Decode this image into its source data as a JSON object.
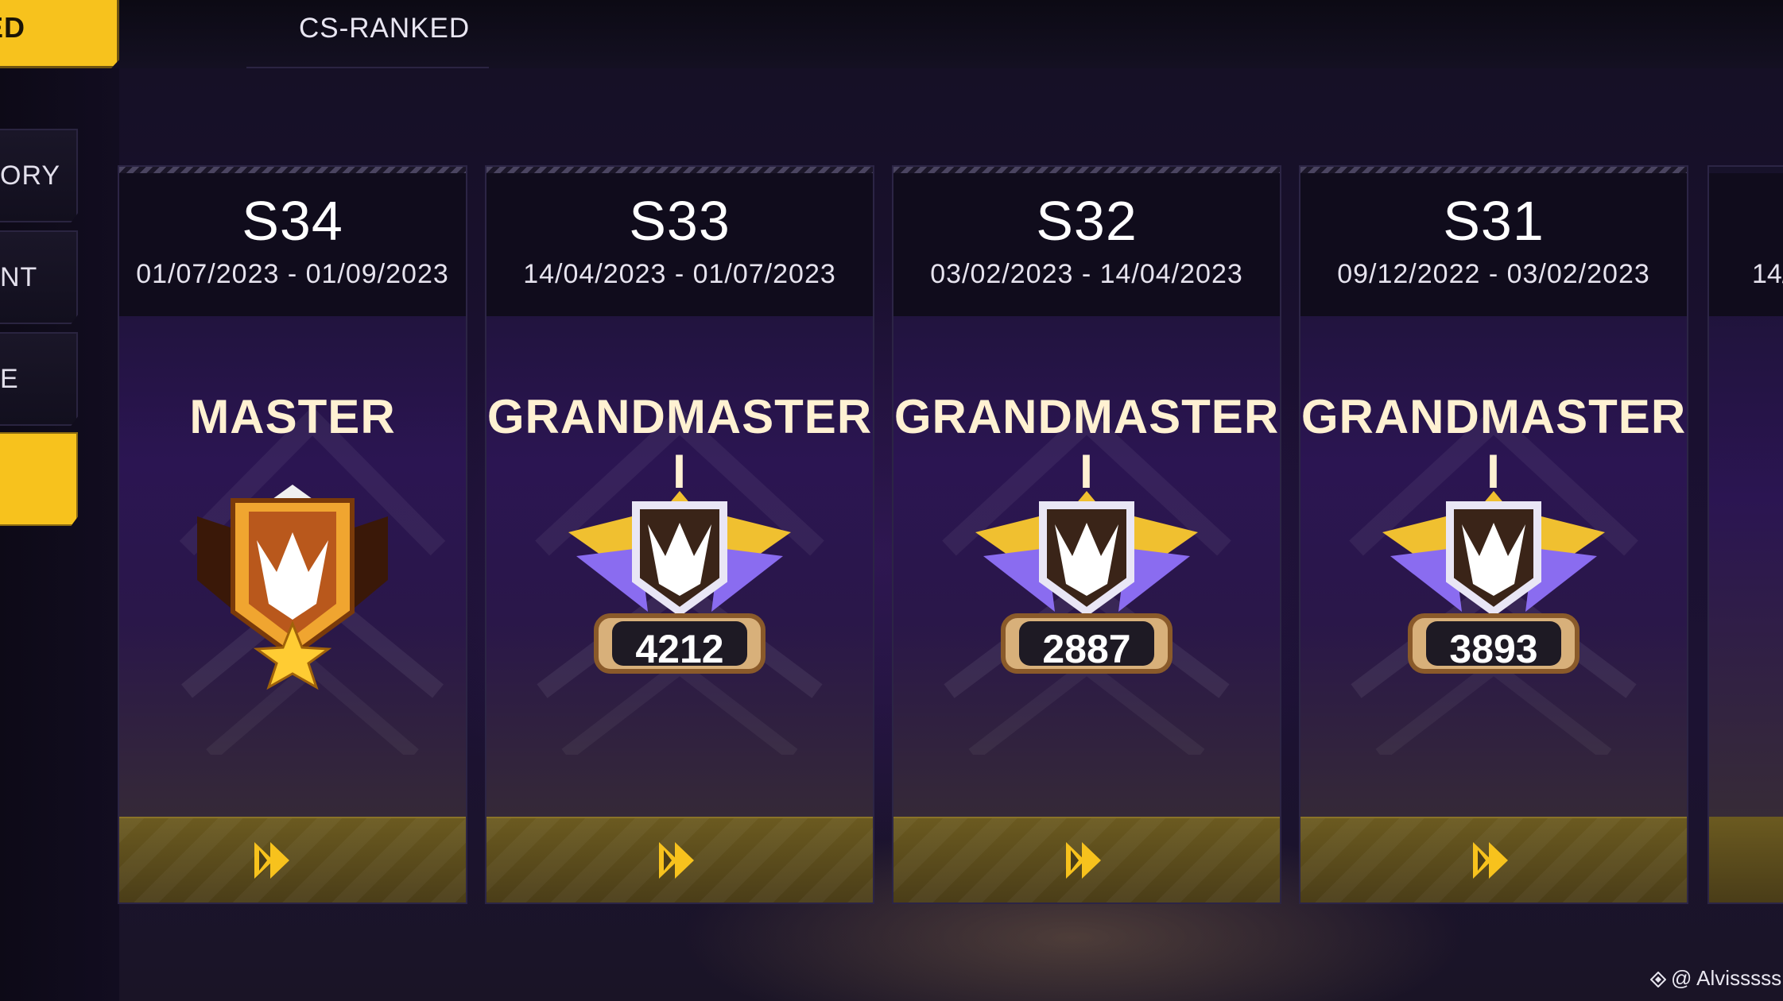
{
  "tabs": {
    "active_label": "ED",
    "cs_label": "CS-RANKED"
  },
  "sidebar": {
    "items": [
      {
        "label": "ORY"
      },
      {
        "label": "NT"
      },
      {
        "label": "E"
      },
      {
        "label": ""
      }
    ]
  },
  "cards": [
    {
      "season": "S34",
      "dates": "01/07/2023 - 01/09/2023",
      "rank": "MASTER",
      "score": "",
      "badge": "master-badge-icon"
    },
    {
      "season": "S33",
      "dates": "14/04/2023 - 01/07/2023",
      "rank": "GRANDMASTER I",
      "score": "4212",
      "badge": "grandmaster-badge-icon"
    },
    {
      "season": "S32",
      "dates": "03/02/2023 - 14/04/2023",
      "rank": "GRANDMASTER I",
      "score": "2887",
      "badge": "grandmaster-badge-icon"
    },
    {
      "season": "S31",
      "dates": "09/12/2022 - 03/02/2023",
      "rank": "GRANDMASTER I",
      "score": "3893",
      "badge": "grandmaster-badge-icon"
    }
  ],
  "partial_card": {
    "dates_fragment": "14/"
  },
  "watermark": "@ Alvisssss",
  "colors": {
    "accent": "#f7c21d",
    "card_top": "#17122a",
    "card_purple": "#2b1552",
    "footer_gold": "#6b5a20"
  }
}
